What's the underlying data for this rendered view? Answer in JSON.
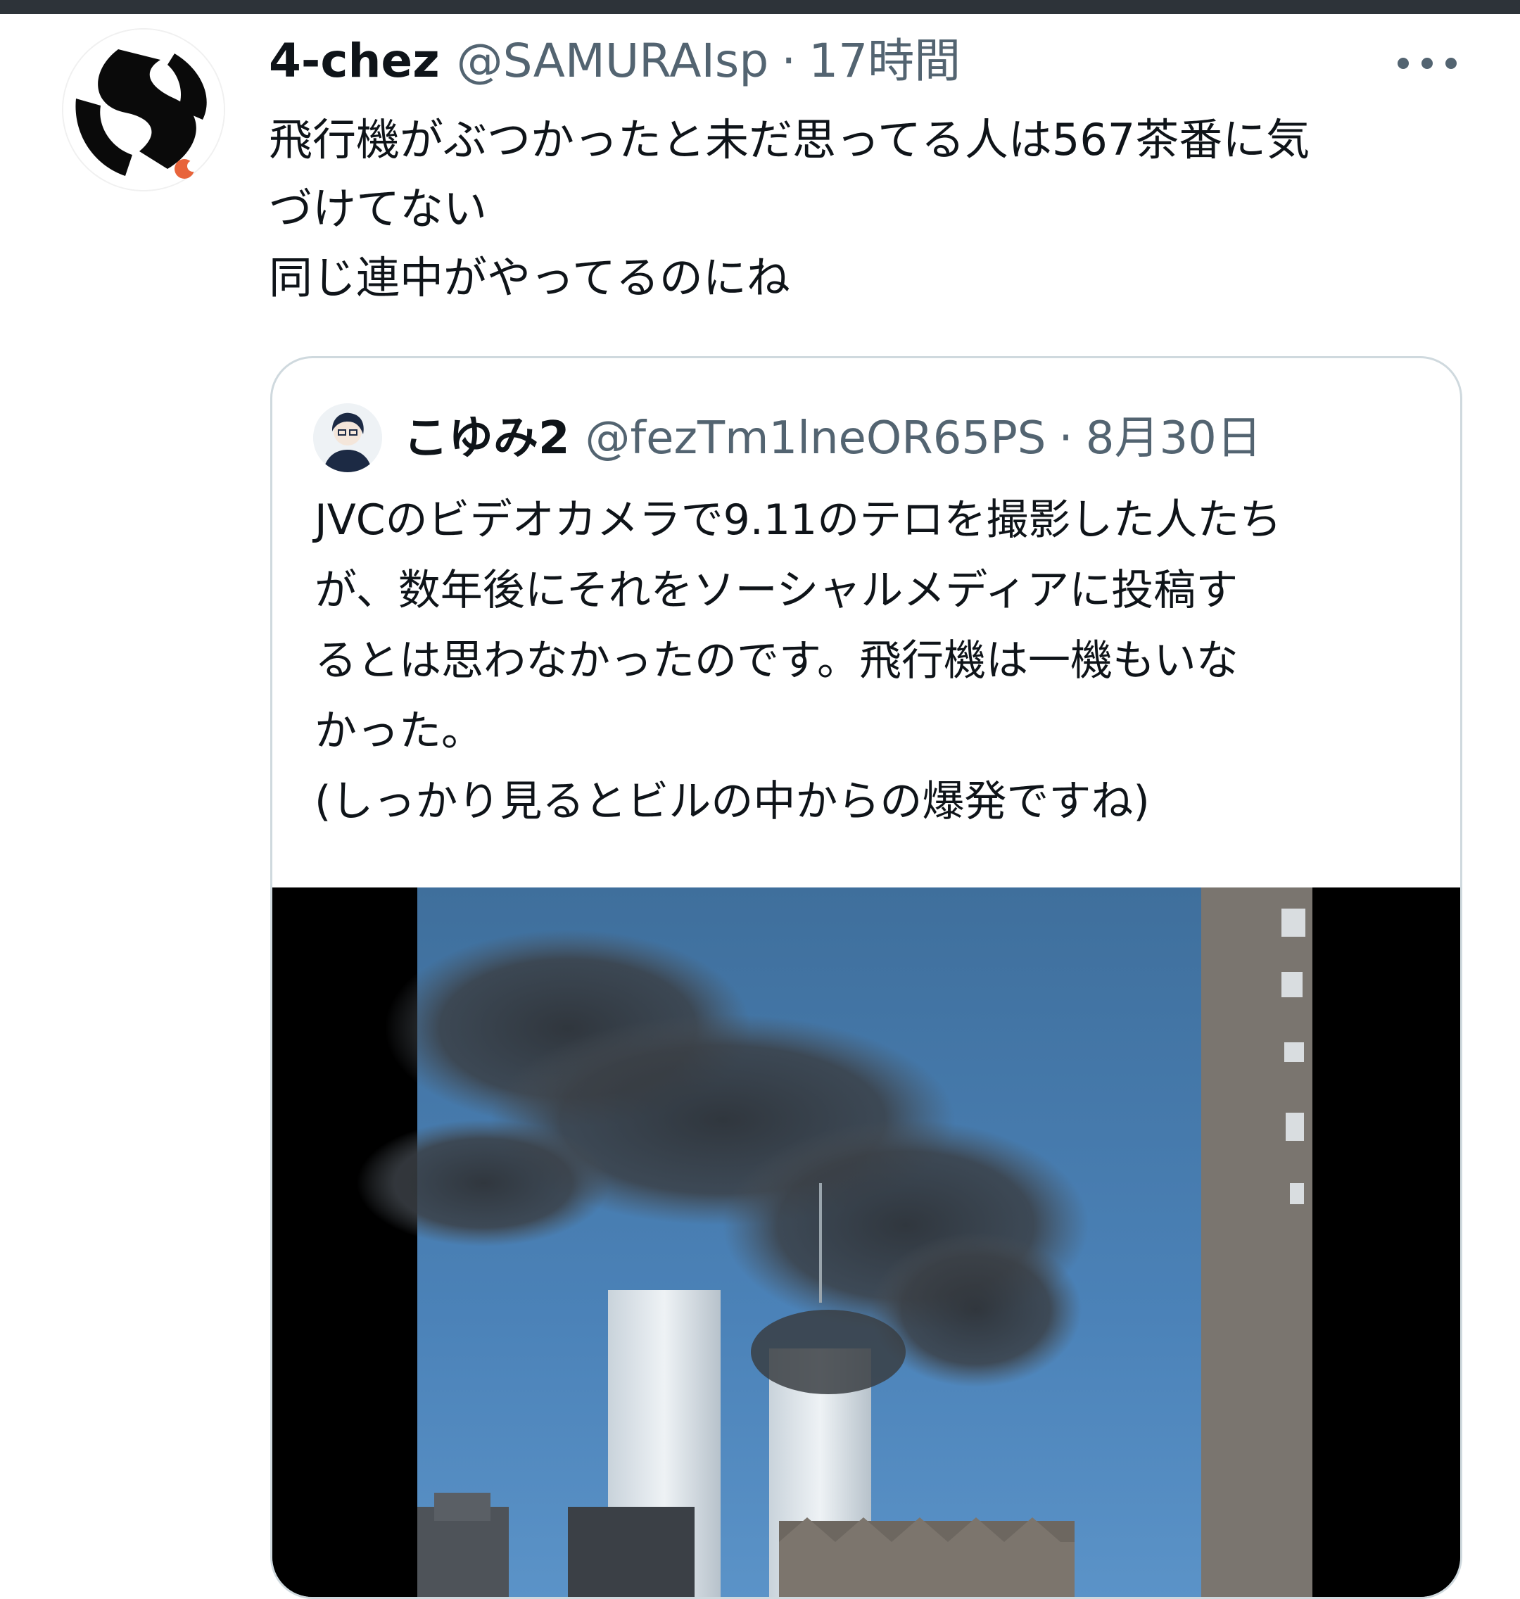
{
  "tweet": {
    "display_name": "4-chez",
    "handle": "@SAMURAIsp",
    "separator": "·",
    "time": "17時間",
    "text_lines": [
      "飛行機がぶつかったと未だ思ってる人は567茶番に気",
      "づけてない",
      "同じ連中がやってるのにね"
    ],
    "avatar_icon": "logo-avatar-icon",
    "more_icon": "more-dots-icon"
  },
  "quote": {
    "display_name": "こゆみ2",
    "handle": "@fezTm1lneOR65PS",
    "separator": "·",
    "date": "8月30日",
    "text_lines": [
      "JVCのビデオカメラで9.11のテロを撮影した人たち",
      "が、数年後にそれをソーシャルメディアに投稿す",
      "るとは思わなかったのです。飛行機は一機もいな",
      "かった。",
      "(しっかり見るとビルの中からの爆発ですね)"
    ],
    "avatar_icon": "person-avatar-icon",
    "media_icon": "video-thumbnail-image"
  },
  "colors": {
    "text_primary": "#0f1419",
    "text_secondary": "#536471",
    "border": "#cfd9de",
    "top_bar": "#2d3339"
  }
}
